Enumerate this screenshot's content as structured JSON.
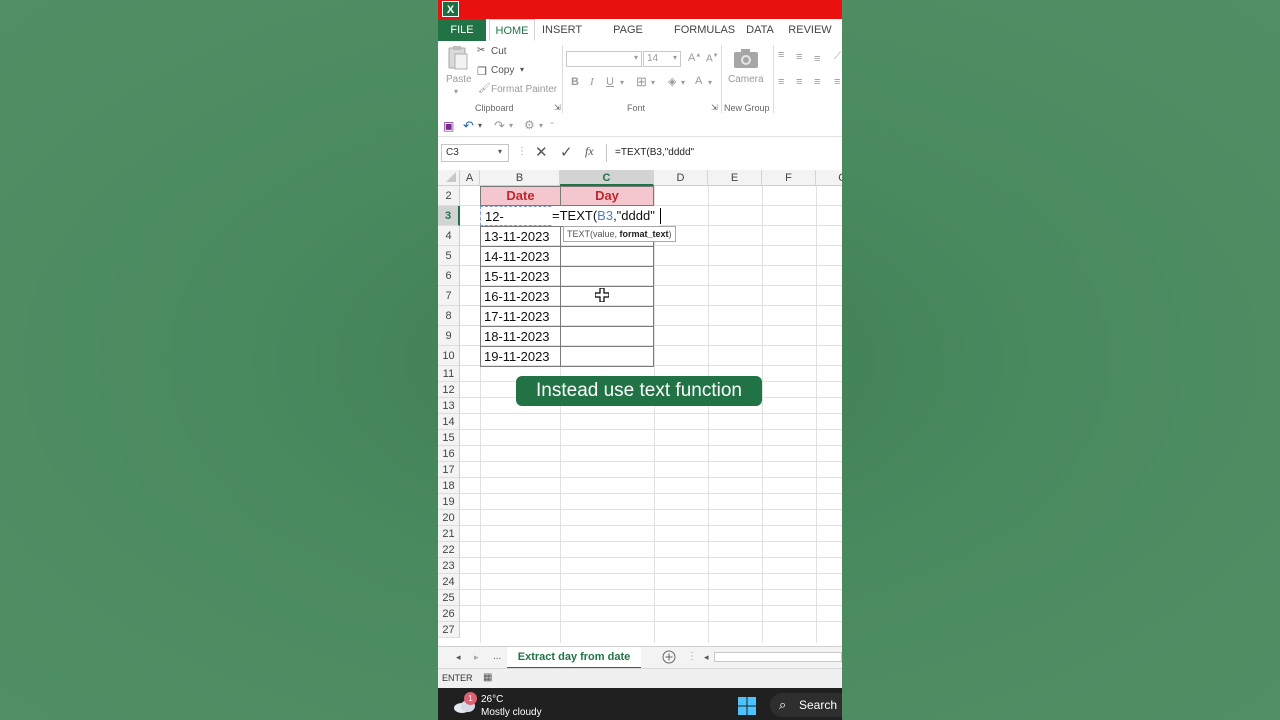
{
  "ribbon_tabs": [
    "FILE",
    "HOME",
    "INSERT",
    "PAGE LAYOUT",
    "FORMULAS",
    "DATA",
    "REVIEW"
  ],
  "clipboard": {
    "paste": "Paste",
    "cut": "Cut",
    "copy": "Copy",
    "format_painter": "Format Painter",
    "group_label": "Clipboard"
  },
  "font": {
    "size": "14",
    "group_label": "Font"
  },
  "new_group": {
    "camera": "Camera",
    "group_label": "New Group"
  },
  "name_box": "C3",
  "formula_bar": {
    "content": "=TEXT(B3,\"dddd\""
  },
  "columns": [
    "A",
    "B",
    "C",
    "D",
    "E",
    "F",
    "G"
  ],
  "rows": [
    "2",
    "3",
    "4",
    "5",
    "6",
    "7",
    "8",
    "9",
    "10",
    "11",
    "12",
    "13",
    "14",
    "15",
    "16",
    "17",
    "18",
    "19",
    "20",
    "21",
    "22",
    "23",
    "24",
    "25",
    "26",
    "27"
  ],
  "table": {
    "header_date": "Date",
    "header_day": "Day",
    "b3_partial": "12-",
    "edit_prefix": "=TEXT(",
    "edit_ref": "B3",
    "edit_suffix": ",\"dddd\"",
    "dates": [
      "13-11-2023",
      "14-11-2023",
      "15-11-2023",
      "16-11-2023",
      "17-11-2023",
      "18-11-2023",
      "19-11-2023"
    ]
  },
  "tooltip": {
    "prefix": "TEXT(value, ",
    "bold": "format_text",
    "suffix": ")"
  },
  "caption": "Instead use text function",
  "sheet_tab": "Extract day from date",
  "sheet_nav_more": "...",
  "status": "ENTER",
  "taskbar": {
    "weather_badge": "1",
    "temperature": "26°C",
    "condition": "Mostly cloudy",
    "search": "Search"
  },
  "colors": {
    "excel_green": "#217346",
    "title_red": "#e8110f",
    "header_fill": "#f4c7cf",
    "header_text": "#c0262d"
  }
}
